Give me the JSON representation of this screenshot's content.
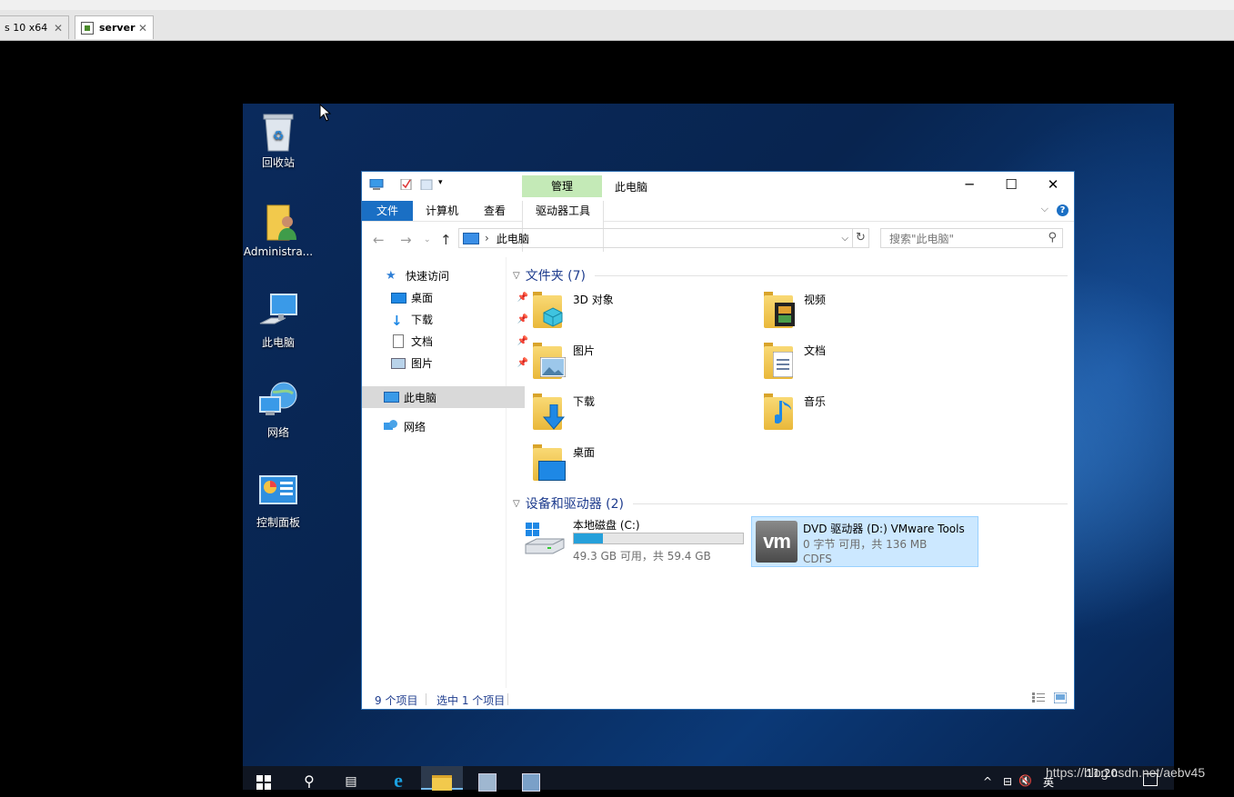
{
  "host": {
    "tabs": [
      {
        "label": "s 10 x64"
      },
      {
        "label": "server"
      }
    ]
  },
  "desktop": {
    "icons": [
      {
        "label": "回收站",
        "icon": "recycle-bin-icon"
      },
      {
        "label": "Administra...",
        "icon": "user-folder-icon"
      },
      {
        "label": "此电脑",
        "icon": "this-pc-icon"
      },
      {
        "label": "网络",
        "icon": "network-icon"
      },
      {
        "label": "控制面板",
        "icon": "control-panel-icon"
      }
    ]
  },
  "explorer": {
    "title": "此电脑",
    "context_tab": "管理",
    "ribbon_tabs": {
      "file": "文件",
      "computer": "计算机",
      "view": "查看",
      "drive_tools": "驱动器工具"
    },
    "address": {
      "path": "此电脑"
    },
    "search": {
      "placeholder": "搜索\"此电脑\""
    },
    "nav": {
      "quick_access": "快速访问",
      "items": [
        "桌面",
        "下载",
        "文档",
        "图片"
      ],
      "this_pc": "此电脑",
      "network": "网络"
    },
    "folders_header": "文件夹 (7)",
    "folders": [
      "3D 对象",
      "视频",
      "图片",
      "文档",
      "下载",
      "音乐",
      "桌面"
    ],
    "drives_header": "设备和驱动器 (2)",
    "drives": [
      {
        "name": "本地磁盘 (C:)",
        "free_text": "49.3 GB 可用，共 59.4 GB",
        "used_fraction": 0.17
      },
      {
        "name": "DVD 驱动器 (D:) VMware Tools",
        "free_text": "0 字节 可用，共 136 MB",
        "fs": "CDFS"
      }
    ],
    "status": {
      "count": "9 个项目",
      "selected": "选中 1 个项目"
    }
  },
  "taskbar": {
    "time": "11:20",
    "ime": "英"
  },
  "watermark": "https://blog.csdn.net/aebv45",
  "colors": {
    "accent": "#1a6fc4",
    "selection": "#cce8ff",
    "manage_tab": "#c4eab7"
  }
}
